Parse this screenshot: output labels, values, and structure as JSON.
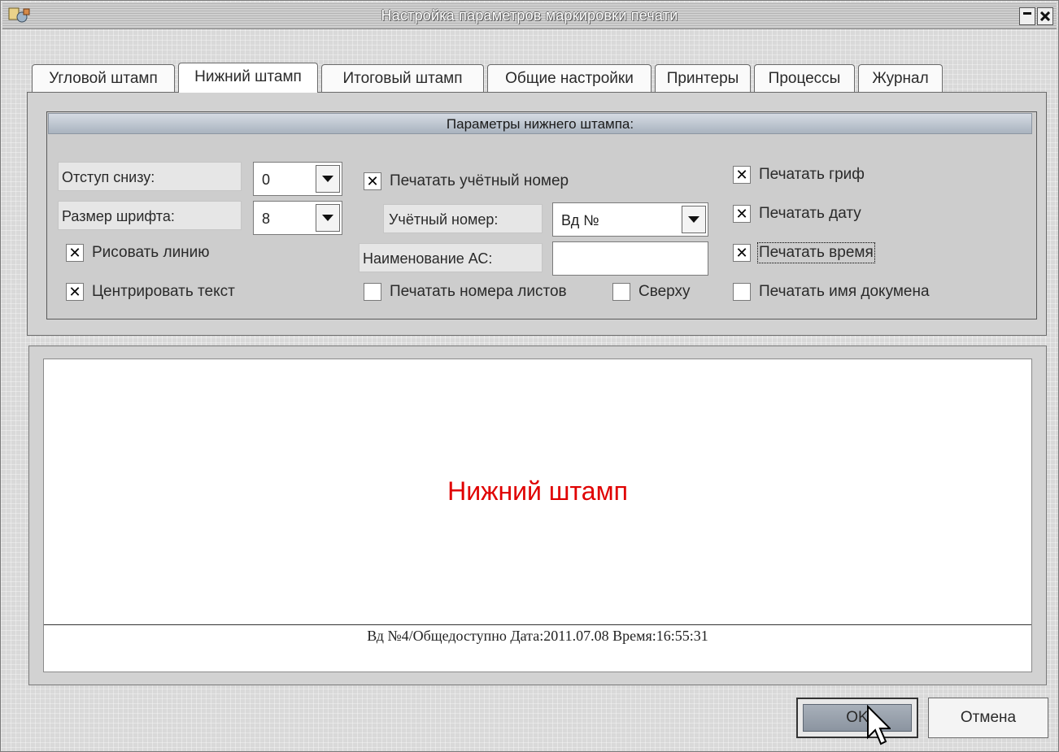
{
  "window": {
    "title": "Настройка параметров маркировки печати"
  },
  "tabs": [
    {
      "label": "Угловой штамп"
    },
    {
      "label": "Нижний штамп"
    },
    {
      "label": "Итоговый штамп"
    },
    {
      "label": "Общие настройки"
    },
    {
      "label": "Принтеры"
    },
    {
      "label": "Процессы"
    },
    {
      "label": "Журнал"
    }
  ],
  "group": {
    "title": "Параметры нижнего штампа:"
  },
  "fields": {
    "offset_label": "Отступ снизу:",
    "offset_value": "0",
    "font_size_label": "Размер шрифта:",
    "font_size_value": "8",
    "account_number_label": "Учётный номер:",
    "account_number_value": "Вд №",
    "as_name_label": "Наименование АС:",
    "as_name_value": ""
  },
  "checkboxes": {
    "draw_line": {
      "label": "Рисовать линию",
      "checked": true
    },
    "center_text": {
      "label": "Центрировать текст",
      "checked": true
    },
    "print_account_number": {
      "label": "Печатать учётный номер",
      "checked": true
    },
    "print_sheet_numbers": {
      "label": "Печатать номера листов",
      "checked": false
    },
    "top": {
      "label": "Сверху",
      "checked": false
    },
    "print_stamp": {
      "label": "Печатать гриф",
      "checked": true
    },
    "print_date": {
      "label": "Печатать дату",
      "checked": true
    },
    "print_time": {
      "label": "Печатать время",
      "checked": true
    },
    "print_doc_name": {
      "label": "Печатать имя докумена",
      "checked": false
    }
  },
  "check_mark": "✕",
  "preview": {
    "title": "Нижний штамп",
    "footer": "Вд №4/Общедоступно Дата:2011.07.08 Время:16:55:31",
    "title_color": "#e00000"
  },
  "buttons": {
    "ok": "OK",
    "cancel": "Отмена"
  }
}
